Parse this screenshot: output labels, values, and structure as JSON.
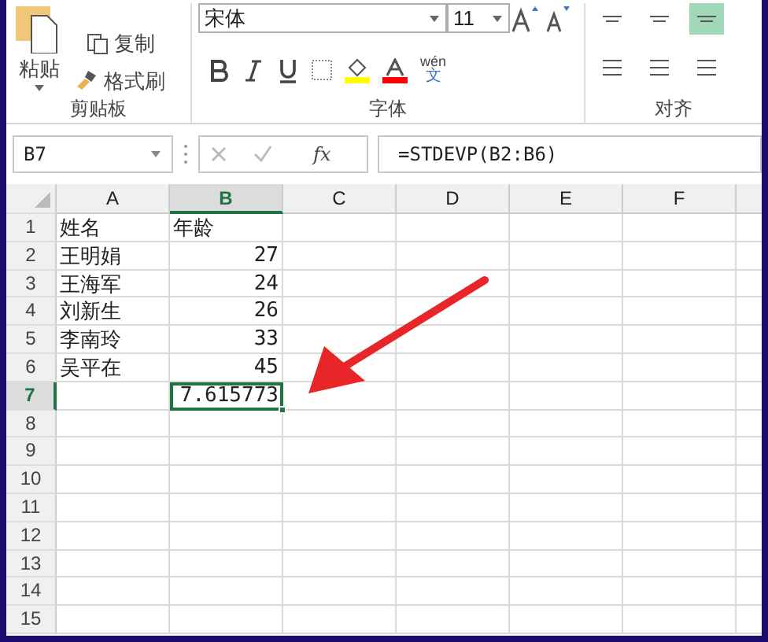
{
  "ribbon": {
    "clipboard": {
      "paste_label": "粘贴",
      "commands": [
        {
          "kind": "copy",
          "label": "复制"
        },
        {
          "kind": "format-painter",
          "label": "格式刷"
        }
      ],
      "group_label": "剪贴板"
    },
    "font": {
      "font_name": "宋体",
      "font_size": "11",
      "group_label": "字体",
      "phonetic_label": "wén",
      "phonetic_char": "文"
    },
    "alignment": {
      "group_label": "对齐",
      "vertical": [
        {
          "selected": false
        },
        {
          "selected": false
        },
        {
          "selected": true
        }
      ]
    }
  },
  "formula_bar": {
    "name_box": "B7",
    "fx": "fx",
    "formula": "=STDEVP(B2:B6)"
  },
  "columns": [
    {
      "label": "A",
      "selected": false
    },
    {
      "label": "B",
      "selected": true
    },
    {
      "label": "C",
      "selected": false
    },
    {
      "label": "D",
      "selected": false
    },
    {
      "label": "E",
      "selected": false
    },
    {
      "label": "F",
      "selected": false
    }
  ],
  "rows": [
    {
      "number": "1",
      "selected": false,
      "cells": [
        {
          "text": "姓名",
          "selected": false
        },
        {
          "text": "年龄",
          "selected": false
        }
      ]
    },
    {
      "number": "2",
      "selected": false,
      "cells": [
        {
          "text": "王明娟",
          "selected": false
        },
        {
          "text": "27",
          "selected": false
        }
      ]
    },
    {
      "number": "3",
      "selected": false,
      "cells": [
        {
          "text": "王海军",
          "selected": false
        },
        {
          "text": "24",
          "selected": false
        }
      ]
    },
    {
      "number": "4",
      "selected": false,
      "cells": [
        {
          "text": "刘新生",
          "selected": false
        },
        {
          "text": "26",
          "selected": false
        }
      ]
    },
    {
      "number": "5",
      "selected": false,
      "cells": [
        {
          "text": "李南玲",
          "selected": false
        },
        {
          "text": "33",
          "selected": false
        }
      ]
    },
    {
      "number": "6",
      "selected": false,
      "cells": [
        {
          "text": "吴平在",
          "selected": false
        },
        {
          "text": "45",
          "selected": false
        }
      ]
    },
    {
      "number": "7",
      "selected": true,
      "cells": [
        {
          "selected": false
        },
        {
          "text": "7.615773",
          "selected": true
        }
      ]
    },
    {
      "number": "8",
      "selected": false
    },
    {
      "number": "9",
      "selected": false
    },
    {
      "number": "10",
      "selected": false
    },
    {
      "number": "11",
      "selected": false
    },
    {
      "number": "12",
      "selected": false
    },
    {
      "number": "13",
      "selected": false
    },
    {
      "number": "14",
      "selected": false
    },
    {
      "number": "15",
      "selected": false
    }
  ]
}
